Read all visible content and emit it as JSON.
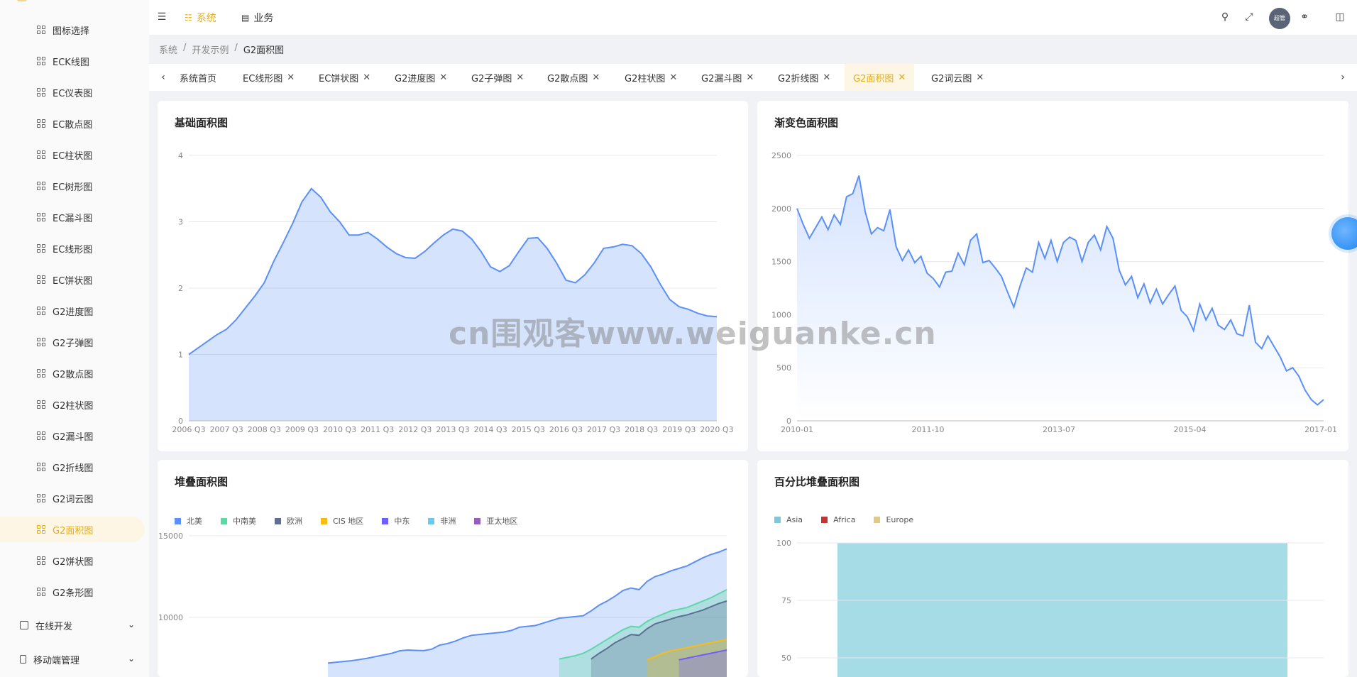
{
  "sidebar": {
    "items": [
      {
        "label": "图标选择",
        "active": false
      },
      {
        "label": "ECK线图",
        "active": false
      },
      {
        "label": "EC仪表图",
        "active": false
      },
      {
        "label": "EC散点图",
        "active": false
      },
      {
        "label": "EC柱状图",
        "active": false
      },
      {
        "label": "EC树形图",
        "active": false
      },
      {
        "label": "EC漏斗图",
        "active": false
      },
      {
        "label": "EC线形图",
        "active": false
      },
      {
        "label": "EC饼状图",
        "active": false
      },
      {
        "label": "G2进度图",
        "active": false
      },
      {
        "label": "G2子弹图",
        "active": false
      },
      {
        "label": "G2散点图",
        "active": false
      },
      {
        "label": "G2柱状图",
        "active": false
      },
      {
        "label": "G2漏斗图",
        "active": false
      },
      {
        "label": "G2折线图",
        "active": false
      },
      {
        "label": "G2词云图",
        "active": false
      },
      {
        "label": "G2面积图",
        "active": true
      },
      {
        "label": "G2饼状图",
        "active": false
      },
      {
        "label": "G2条形图",
        "active": false
      }
    ],
    "groups": [
      {
        "label": "在线开发",
        "icon": "layout-icon"
      },
      {
        "label": "移动端管理",
        "icon": "mobile-icon"
      }
    ]
  },
  "header": {
    "menu_system": "系统",
    "menu_business": "业务",
    "avatar_text": "超管",
    "accent": "#e3ae1b"
  },
  "breadcrumb": [
    "系统",
    "/",
    "开发示例",
    "/",
    "G2面积图"
  ],
  "tabs": [
    {
      "label": "系统首页",
      "closable": false,
      "active": false
    },
    {
      "label": "EC线形图",
      "closable": true,
      "active": false
    },
    {
      "label": "EC饼状图",
      "closable": true,
      "active": false
    },
    {
      "label": "G2进度图",
      "closable": true,
      "active": false
    },
    {
      "label": "G2子弹图",
      "closable": true,
      "active": false
    },
    {
      "label": "G2散点图",
      "closable": true,
      "active": false
    },
    {
      "label": "G2柱状图",
      "closable": true,
      "active": false
    },
    {
      "label": "G2漏斗图",
      "closable": true,
      "active": false
    },
    {
      "label": "G2折线图",
      "closable": true,
      "active": false
    },
    {
      "label": "G2面积图",
      "closable": true,
      "active": true
    },
    {
      "label": "G2词云图",
      "closable": true,
      "active": false
    }
  ],
  "watermark": "cn围观客www.weiguanke.cn",
  "cards": {
    "basic": {
      "title": "基础面积图"
    },
    "gradient": {
      "title": "渐变色面积图"
    },
    "stacked": {
      "title": "堆叠面积图"
    },
    "percent": {
      "title": "百分比堆叠面积图"
    }
  },
  "chart_data": [
    {
      "type": "area",
      "title": "基础面积图",
      "ylim": [
        0,
        4
      ],
      "yticks": [
        0,
        1,
        2,
        3,
        4
      ],
      "xticks": [
        "2006 Q3",
        "2007 Q3",
        "2008 Q3",
        "2009 Q3",
        "2010 Q3",
        "2011 Q3",
        "2012 Q3",
        "2013 Q3",
        "2014 Q3",
        "2015 Q3",
        "2016 Q3",
        "2017 Q3",
        "2018 Q3",
        "2019 Q3",
        "2020 Q3"
      ],
      "x": [
        2006.5,
        2006.75,
        2007,
        2007.25,
        2007.5,
        2007.75,
        2008,
        2008.25,
        2008.5,
        2008.75,
        2009,
        2009.25,
        2009.5,
        2009.75,
        2010,
        2010.25,
        2010.5,
        2010.75,
        2011,
        2011.25,
        2011.5,
        2011.75,
        2012,
        2012.25,
        2012.5,
        2012.75,
        2013,
        2013.25,
        2013.5,
        2013.75,
        2014,
        2014.25,
        2014.5,
        2014.75,
        2015,
        2015.25,
        2015.5,
        2015.75,
        2016,
        2016.25,
        2016.5,
        2016.75,
        2017,
        2017.25,
        2017.5,
        2017.75,
        2018,
        2018.25,
        2018.5,
        2018.75,
        2019,
        2019.25,
        2019.5,
        2019.75,
        2020,
        2020.25,
        2020.5
      ],
      "values": [
        1.0,
        1.1,
        1.2,
        1.3,
        1.38,
        1.52,
        1.7,
        1.88,
        2.08,
        2.4,
        2.68,
        2.97,
        3.3,
        3.5,
        3.37,
        3.15,
        3.0,
        2.8,
        2.8,
        2.84,
        2.74,
        2.62,
        2.52,
        2.46,
        2.45,
        2.55,
        2.68,
        2.8,
        2.89,
        2.86,
        2.74,
        2.55,
        2.32,
        2.25,
        2.34,
        2.55,
        2.75,
        2.76,
        2.6,
        2.38,
        2.12,
        2.08,
        2.2,
        2.38,
        2.6,
        2.62,
        2.66,
        2.64,
        2.52,
        2.32,
        2.06,
        1.83,
        1.72,
        1.68,
        1.62,
        1.58,
        1.57
      ],
      "color": "#5b8ff9"
    },
    {
      "type": "area",
      "title": "渐变色面积图",
      "ylim": [
        0,
        2500
      ],
      "yticks": [
        0,
        500,
        1000,
        1500,
        2000,
        2500
      ],
      "xticks": [
        "2010-01",
        "2011-10",
        "2013-07",
        "2015-04",
        "2017-01"
      ],
      "values": [
        2000,
        1850,
        1720,
        1820,
        1920,
        1800,
        1940,
        1850,
        2110,
        2140,
        2310,
        1970,
        1760,
        1820,
        1790,
        1990,
        1640,
        1510,
        1610,
        1490,
        1550,
        1390,
        1340,
        1260,
        1400,
        1410,
        1580,
        1470,
        1700,
        1760,
        1490,
        1510,
        1440,
        1360,
        1210,
        1070,
        1270,
        1440,
        1400,
        1680,
        1530,
        1700,
        1500,
        1680,
        1730,
        1700,
        1500,
        1680,
        1750,
        1610,
        1830,
        1720,
        1420,
        1280,
        1360,
        1160,
        1290,
        1110,
        1240,
        1100,
        1190,
        1270,
        1040,
        980,
        850,
        1100,
        950,
        1060,
        900,
        860,
        950,
        820,
        800,
        1090,
        740,
        680,
        800,
        700,
        600,
        470,
        500,
        420,
        290,
        200,
        150,
        200
      ],
      "color": "#5b8ff9",
      "gradient_from": "#d6e4ff",
      "gradient_to": "#ffffff"
    },
    {
      "type": "area",
      "title": "堆叠面积图",
      "stacked": true,
      "yticks_visible": [
        10000,
        15000
      ],
      "legend": [
        {
          "name": "北美",
          "color": "#5b8ff9"
        },
        {
          "name": "中南美",
          "color": "#5ad8a6"
        },
        {
          "name": "欧洲",
          "color": "#5d7092"
        },
        {
          "name": "CIS 地区",
          "color": "#f6bd16"
        },
        {
          "name": "中东",
          "color": "#6f5ef9"
        },
        {
          "name": "非洲",
          "color": "#6dc8ec"
        },
        {
          "name": "亚太地区",
          "color": "#945fb9"
        }
      ],
      "series_visible_tops": {
        "北美": [
          7200,
          7250,
          7300,
          7350,
          7420,
          7500,
          7600,
          7700,
          7800,
          7950,
          8000,
          7980,
          7960,
          8050,
          8300,
          8400,
          8550,
          8750,
          8900,
          8950,
          9000,
          9050,
          9100,
          9200,
          9400,
          9450,
          9500,
          9650,
          9800,
          9950,
          10000,
          10050,
          10100,
          10400,
          10750,
          11000,
          11300,
          11650,
          11800,
          11700,
          12200,
          12500,
          12650,
          12850,
          13000,
          13150,
          13400,
          13650,
          13850,
          14000,
          14200
        ],
        "中南美": [
          null,
          null,
          null,
          null,
          null,
          null,
          null,
          null,
          null,
          null,
          null,
          null,
          null,
          null,
          null,
          null,
          null,
          null,
          null,
          null,
          null,
          null,
          null,
          null,
          null,
          null,
          null,
          null,
          null,
          7450,
          7550,
          7650,
          7800,
          8050,
          8350,
          8650,
          8950,
          9250,
          9450,
          9400,
          9750,
          10000,
          10200,
          10400,
          10500,
          10600,
          10800,
          11000,
          11200,
          11450,
          11700
        ],
        "欧洲": [
          null,
          null,
          null,
          null,
          null,
          null,
          null,
          null,
          null,
          null,
          null,
          null,
          null,
          null,
          null,
          null,
          null,
          null,
          null,
          null,
          null,
          null,
          null,
          null,
          null,
          null,
          null,
          null,
          null,
          null,
          null,
          null,
          null,
          7450,
          7800,
          8100,
          8450,
          8700,
          8950,
          8900,
          9300,
          9600,
          9750,
          9900,
          10050,
          10150,
          10300,
          10450,
          10650,
          10850,
          11000
        ],
        "CIS 地区": [
          null,
          null,
          null,
          null,
          null,
          null,
          null,
          null,
          null,
          null,
          null,
          null,
          null,
          null,
          null,
          null,
          null,
          null,
          null,
          null,
          null,
          null,
          null,
          null,
          null,
          null,
          null,
          null,
          null,
          null,
          null,
          null,
          null,
          null,
          null,
          null,
          null,
          null,
          null,
          null,
          7400,
          7600,
          7800,
          7950,
          8050,
          8150,
          8250,
          8350,
          8450,
          8550,
          8650
        ],
        "中东": [
          null,
          null,
          null,
          null,
          null,
          null,
          null,
          null,
          null,
          null,
          null,
          null,
          null,
          null,
          null,
          null,
          null,
          null,
          null,
          null,
          null,
          null,
          null,
          null,
          null,
          null,
          null,
          null,
          null,
          null,
          null,
          null,
          null,
          null,
          null,
          null,
          null,
          null,
          null,
          null,
          null,
          null,
          null,
          null,
          7400,
          7500,
          7600,
          7700,
          7800,
          7900,
          8000
        ]
      }
    },
    {
      "type": "area",
      "title": "百分比堆叠面积图",
      "stacked": true,
      "percent": true,
      "yticks_visible": [
        50,
        75,
        100
      ],
      "legend": [
        {
          "name": "Asia",
          "color": "#7ec8d9"
        },
        {
          "name": "Africa",
          "color": "#c23531"
        },
        {
          "name": "Europe",
          "color": "#e0c98a"
        }
      ],
      "visible_fill_color": "#a5dce6"
    }
  ]
}
